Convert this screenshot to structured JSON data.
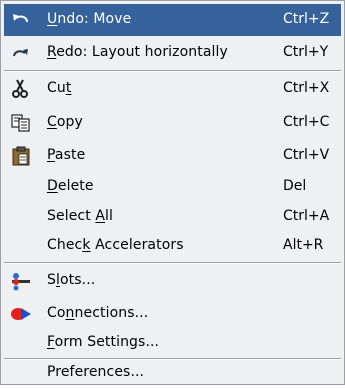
{
  "menu": {
    "items": [
      {
        "id": "undo",
        "pre": "",
        "mn": "U",
        "post": "ndo: Move",
        "accel": "Ctrl+Z",
        "icon": "undo-arrow-icon",
        "highlighted": true
      },
      {
        "id": "redo",
        "pre": "",
        "mn": "R",
        "post": "edo: Layout horizontally",
        "accel": "Ctrl+Y",
        "icon": "redo-arrow-icon",
        "highlighted": false
      },
      {
        "id": "cut",
        "pre": "Cu",
        "mn": "t",
        "post": "",
        "accel": "Ctrl+X",
        "icon": "scissors-icon",
        "highlighted": false
      },
      {
        "id": "copy",
        "pre": "",
        "mn": "C",
        "post": "opy",
        "accel": "Ctrl+C",
        "icon": "copy-icon",
        "highlighted": false
      },
      {
        "id": "paste",
        "pre": "",
        "mn": "P",
        "post": "aste",
        "accel": "Ctrl+V",
        "icon": "clipboard-icon",
        "highlighted": false
      },
      {
        "id": "delete",
        "pre": "",
        "mn": "D",
        "post": "elete",
        "accel": "Del",
        "icon": "",
        "highlighted": false
      },
      {
        "id": "select-all",
        "pre": "Select ",
        "mn": "A",
        "post": "ll",
        "accel": "Ctrl+A",
        "icon": "",
        "highlighted": false
      },
      {
        "id": "check-accelerators",
        "pre": "Chec",
        "mn": "k",
        "post": " Accelerators",
        "accel": "Alt+R",
        "icon": "",
        "highlighted": false
      },
      {
        "id": "slots",
        "pre": "S",
        "mn": "l",
        "post": "ots...",
        "accel": "",
        "icon": "slots-icon",
        "highlighted": false
      },
      {
        "id": "connections",
        "pre": "Co",
        "mn": "n",
        "post": "nections...",
        "accel": "",
        "icon": "connections-icon",
        "highlighted": false
      },
      {
        "id": "form-settings",
        "pre": "",
        "mn": "F",
        "post": "orm Settings...",
        "accel": "",
        "icon": "",
        "highlighted": false
      },
      {
        "id": "preferences",
        "pre": "Preferences...",
        "mn": "",
        "post": "",
        "accel": "",
        "icon": "",
        "highlighted": false
      }
    ]
  },
  "colors": {
    "highlight": "#35629a",
    "menu_bg": "#eef0f2",
    "separator": "#9aa1a8"
  }
}
